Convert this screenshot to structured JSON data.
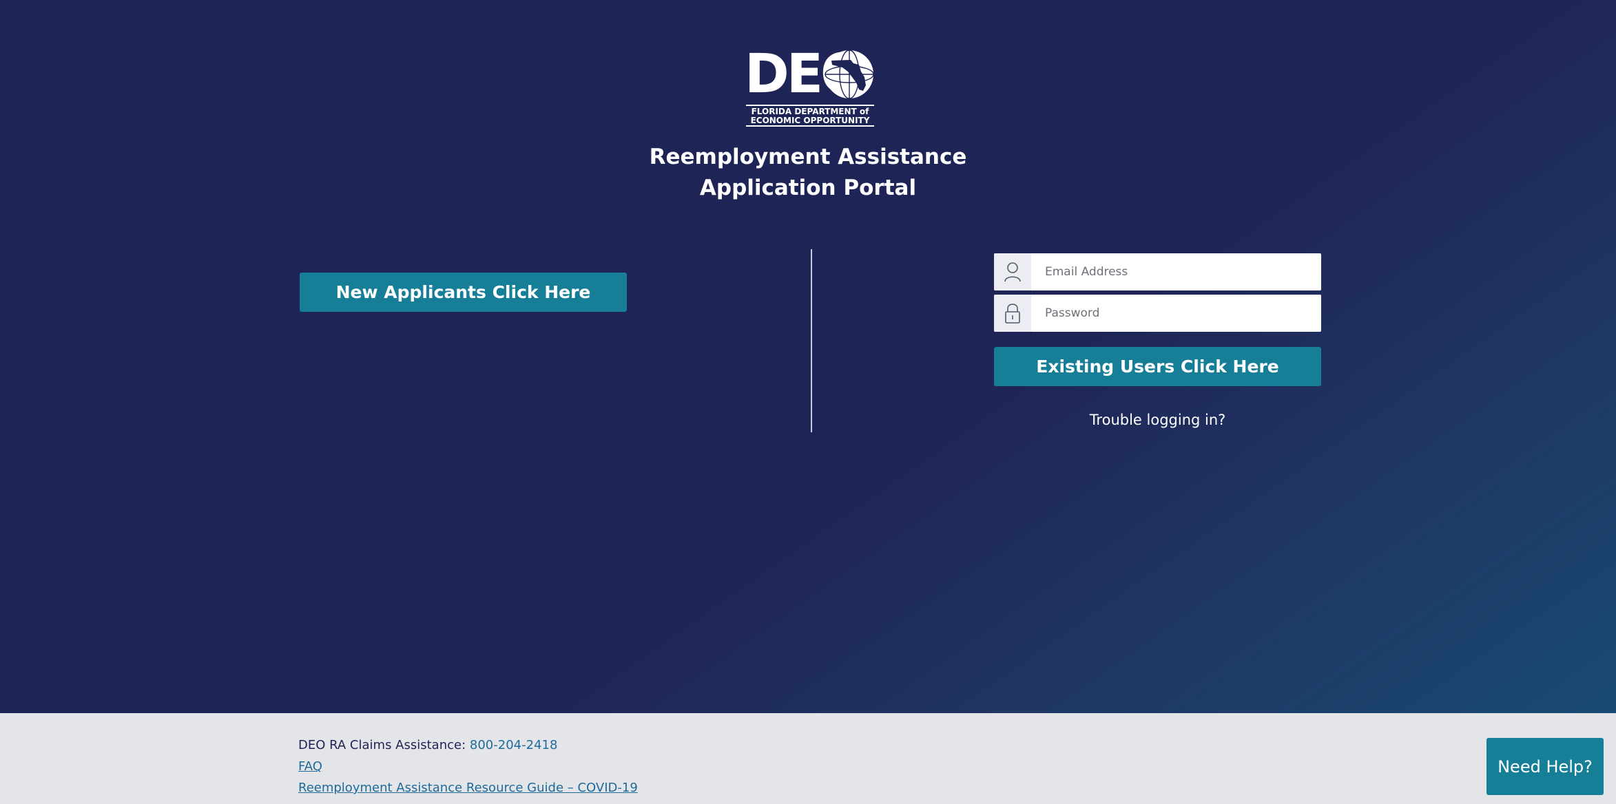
{
  "logo": {
    "wordmark": "DEO",
    "subtitle_line1": "FLORIDA DEPARTMENT of",
    "subtitle_line2": "ECONOMIC OPPORTUNITY"
  },
  "page": {
    "title_line1": "Reemployment Assistance",
    "title_line2": "Application Portal"
  },
  "new_applicants": {
    "button_label": "New Applicants Click Here"
  },
  "login": {
    "email_placeholder": "Email Address",
    "email_value": "",
    "password_placeholder": "Password",
    "password_value": "",
    "submit_label": "Existing Users Click Here",
    "trouble_link": "Trouble logging in?"
  },
  "footer": {
    "claims_label": "DEO RA Claims Assistance:",
    "claims_phone": "800-204-2418",
    "faq_link": "FAQ",
    "guide_link": "Reemployment Assistance Resource Guide – COVID-19"
  },
  "help": {
    "button_label": "Need Help?"
  },
  "colors": {
    "background": "#1f2456",
    "accent": "#167f97",
    "footer_bg": "#e4e5e8",
    "link": "#1f6a9a"
  },
  "icons": {
    "email_field": "user-icon",
    "password_field": "lock-icon",
    "logo_mark": "florida-globe-icon"
  }
}
